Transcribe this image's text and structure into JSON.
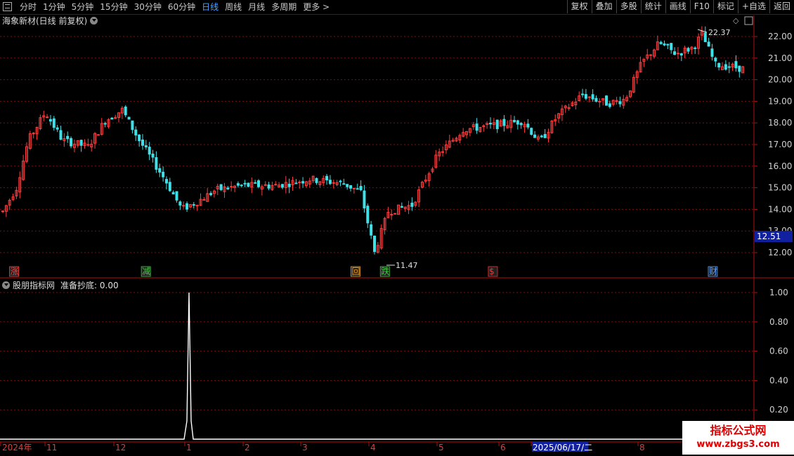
{
  "toolbar": {
    "periods": [
      "分时",
      "1分钟",
      "5分钟",
      "15分钟",
      "30分钟",
      "60分钟",
      "日线",
      "周线",
      "月线",
      "多周期",
      "更多 >"
    ],
    "active_period": "日线",
    "tools": [
      "复权",
      "叠加",
      "多股",
      "统计",
      "画线",
      "F10",
      "标记",
      "+自选",
      "返回"
    ]
  },
  "main_chart": {
    "title": "海象新材(日线 前复权)",
    "high_label": "22.37",
    "low_label": "11.47",
    "current_price": "12.51",
    "y_ticks": [
      "22.00",
      "21.00",
      "20.00",
      "19.00",
      "18.00",
      "17.00",
      "16.00",
      "15.00",
      "14.00",
      "13.00",
      "12.00"
    ],
    "markers": [
      {
        "text": "涨",
        "color": "#ff4040",
        "x": 0.012
      },
      {
        "text": "减",
        "color": "#40d040",
        "x": 0.178
      },
      {
        "text": "回",
        "color": "#f0a020",
        "x": 0.442
      },
      {
        "text": "跌",
        "color": "#40d040",
        "x": 0.479
      },
      {
        "text": "$",
        "color": "#ff3030",
        "x": 0.615
      },
      {
        "text": "财",
        "color": "#5aa0ff",
        "x": 0.892
      }
    ]
  },
  "sub_chart": {
    "indicator_name": "股朋指标网",
    "series_label": "准备抄底: 0.00",
    "y_ticks": [
      "1.00",
      "0.80",
      "0.60",
      "0.40",
      "0.20"
    ]
  },
  "x_axis": {
    "labels": [
      "2024年",
      "11",
      "12",
      "1",
      "2",
      "3",
      "4",
      "5",
      "6",
      "2025/06/17/二",
      "8"
    ],
    "highlight": "2025/06/17/二"
  },
  "watermark": {
    "line1": "指标公式网",
    "line2": "www.zbgs3.com"
  },
  "colors": {
    "up": "#ff3c3c",
    "down": "#3fe0e8",
    "grid": "#7a1010",
    "axis": "#b01010"
  }
}
